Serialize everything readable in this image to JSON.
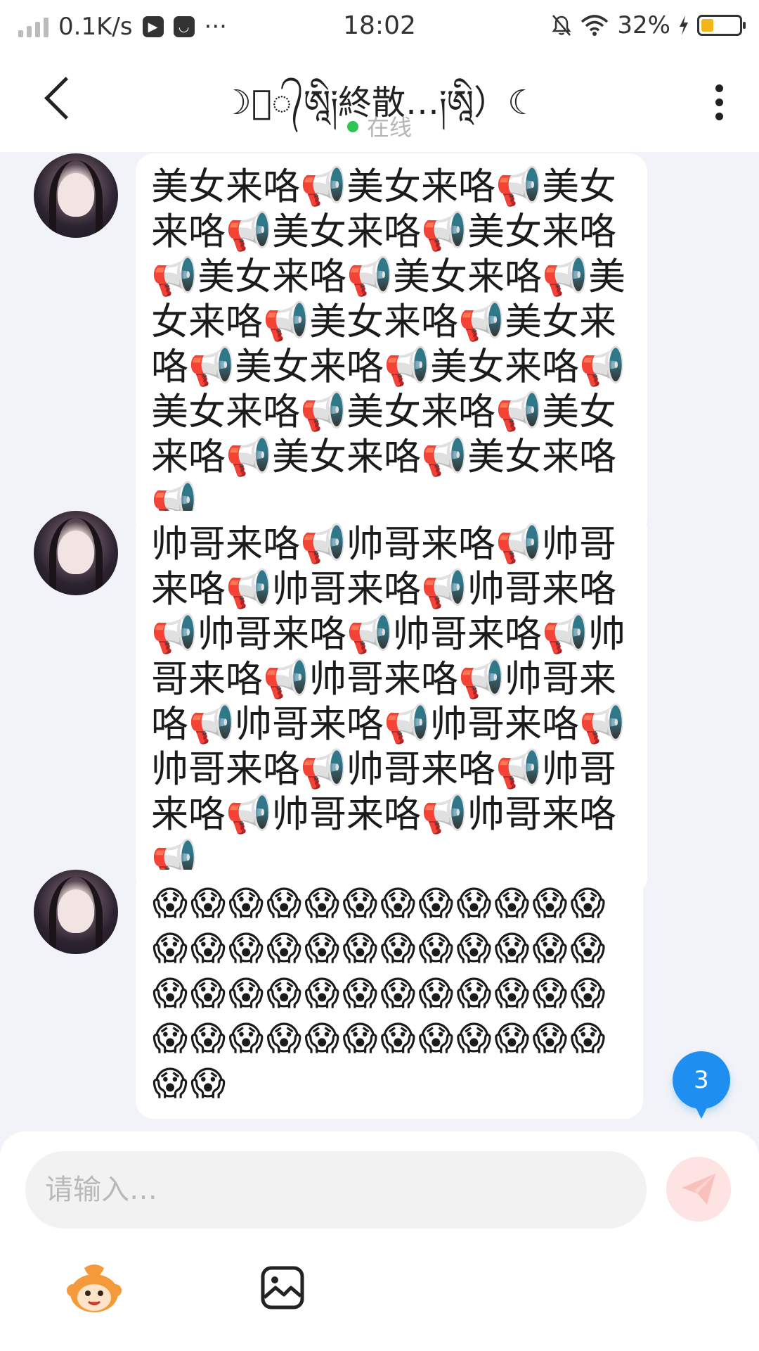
{
  "status_bar": {
    "speed": "0.1K/s",
    "more": "···",
    "time": "18:02",
    "battery": "32%",
    "battery_level": 0.32
  },
  "header": {
    "title": "☽ꦿ᭄ཨཱི༏終散…༏ཨཱི）☾",
    "status": "在线"
  },
  "messages": [
    {
      "sender": "contact",
      "text": "美女来咯📢美女来咯📢美女来咯📢美女来咯📢美女来咯📢美女来咯📢美女来咯📢美女来咯📢美女来咯📢美女来咯📢美女来咯📢美女来咯📢美女来咯📢美女来咯📢美女来咯📢美女来咯📢美女来咯📢"
    },
    {
      "sender": "contact",
      "text": "帅哥来咯📢帅哥来咯📢帅哥来咯📢帅哥来咯📢帅哥来咯📢帅哥来咯📢帅哥来咯📢帅哥来咯📢帅哥来咯📢帅哥来咯📢帅哥来咯📢帅哥来咯📢帅哥来咯📢帅哥来咯📢帅哥来咯📢帅哥来咯📢帅哥来咯📢"
    },
    {
      "sender": "contact",
      "text": "😱😱😱😱😱😱😱😱😱😱😱😱😱😱😱😱😱😱😱😱😱😱😱😱😱😱😱😱😱😱😱😱😱😱😱😱😱😱😱😱😱😱😱😱😱😱😱😱😱😱"
    }
  ],
  "unread_count": "3",
  "composer": {
    "placeholder": "请输入…"
  },
  "icons": {
    "back": "chevron-left-icon",
    "more": "more-vertical-icon",
    "send": "send-icon",
    "emoji": "monkey-mascot-icon",
    "image": "image-icon"
  },
  "colors": {
    "background": "#f1f3f8",
    "online_dot": "#2cc651",
    "unread_badge": "#1e8ff0",
    "send_button": "#fde3e2"
  }
}
